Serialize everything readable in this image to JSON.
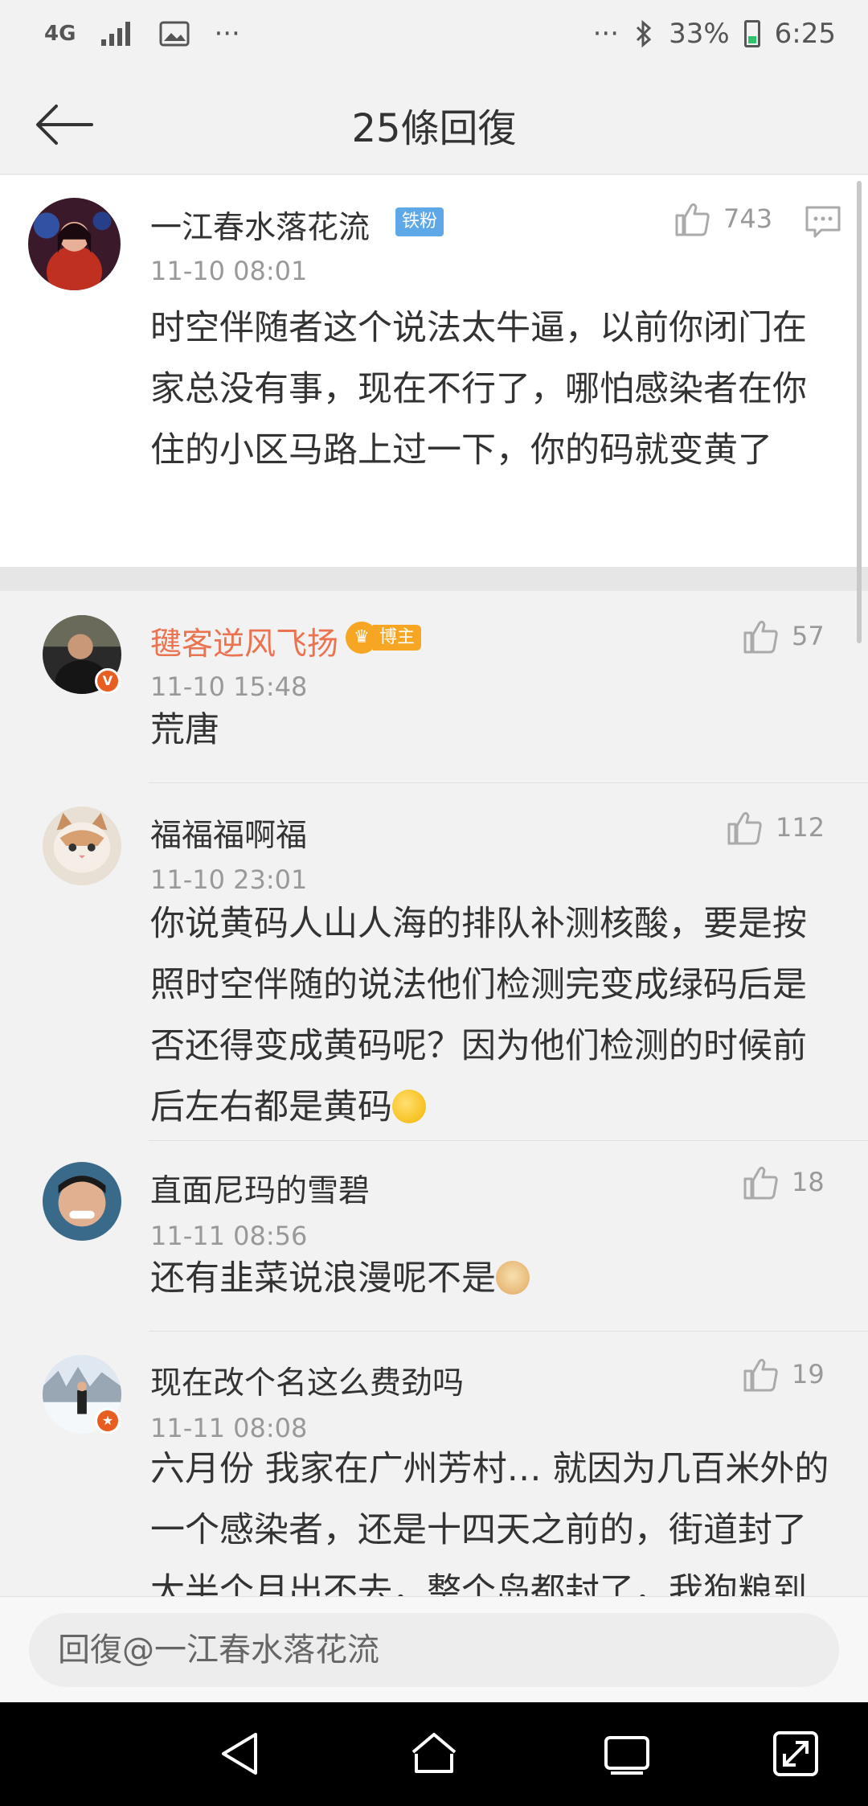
{
  "status_bar": {
    "network": "4G",
    "overflow": "···",
    "overflow_right": "···",
    "battery": "33%",
    "time": "6:25"
  },
  "header": {
    "title": "25條回復"
  },
  "main_comment": {
    "user": "一江春水落花流",
    "badge": "铁粉",
    "time": "11-10 08:01",
    "likes": "743",
    "text": "时空伴随者这个说法太牛逼，以前你闭门在家总没有事，现在不行了，哪怕感染者在你住的小区马路上过一下，你的码就变黄了"
  },
  "replies": [
    {
      "user": "毽客逆风飞扬",
      "badge": "博主",
      "time": "11-10 15:48",
      "likes": "57",
      "text": "荒唐"
    },
    {
      "user": "福福福啊福",
      "time": "11-10 23:01",
      "likes": "112",
      "text": "你说黄码人山人海的排队补测核酸，要是按照时空伴随的说法他们检测完变成绿码后是否还得变成黄码呢？因为他们检测的时候前后左右都是黄码"
    },
    {
      "user": "直面尼玛的雪碧",
      "time": "11-11 08:56",
      "likes": "18",
      "text": "还有韭菜说浪漫呢不是"
    },
    {
      "user": "现在改个名这么费劲吗",
      "time": "11-11 08:08",
      "likes": "19",
      "text": "六月份 我家在广州芳村… 就因为几百米外的一个感染者，还是十四天之前的，街道封了大半个月出不去，整个岛都封了，我狗粮到了也"
    }
  ],
  "reply_input": {
    "placeholder": "回復@一江春水落花流"
  },
  "colors": {
    "accent_orange": "#eb7350",
    "fan_badge": "#5ea8e8",
    "blogger_badge": "#f6a623"
  }
}
